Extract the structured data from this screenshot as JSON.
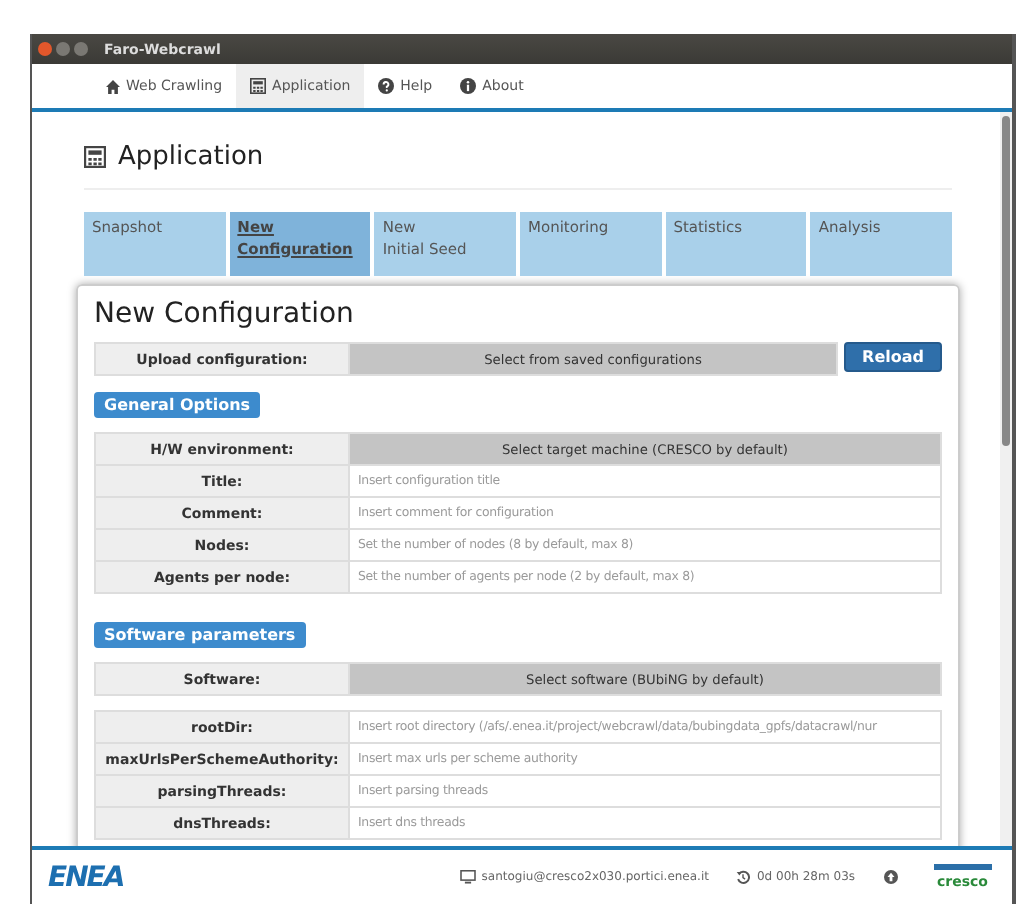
{
  "window": {
    "title": "Faro-Webcrawl"
  },
  "nav": [
    {
      "label": "Web Crawling",
      "selected": false
    },
    {
      "label": "Application",
      "selected": true
    },
    {
      "label": "Help",
      "selected": false
    },
    {
      "label": "About",
      "selected": false
    }
  ],
  "page_heading": "Application",
  "tabs": [
    {
      "label": "Snapshot",
      "selected": false
    },
    {
      "label": "New\nConfiguration",
      "selected": true
    },
    {
      "label": "New\nInitial Seed",
      "selected": false
    },
    {
      "label": "Monitoring",
      "selected": false
    },
    {
      "label": "Statistics",
      "selected": false
    },
    {
      "label": "Analysis",
      "selected": false
    }
  ],
  "card": {
    "title": "New Configuration",
    "upload": {
      "label": "Upload configuration:",
      "value": "Select from saved configurations",
      "button": "Reload"
    },
    "sections": [
      {
        "title": "General Options",
        "groups": [
          [
            {
              "kind": "select",
              "label": "H/W environment:",
              "value": "Select target machine (CRESCO by default)"
            },
            {
              "kind": "input",
              "label": "Title:",
              "placeholder": "Insert configuration title"
            },
            {
              "kind": "input",
              "label": "Comment:",
              "placeholder": "Insert comment for configuration"
            },
            {
              "kind": "input",
              "label": "Nodes:",
              "placeholder": "Set the number of nodes (8 by default, max 8)"
            },
            {
              "kind": "input",
              "label": "Agents per node:",
              "placeholder": "Set the number of agents per node (2 by default, max 8)"
            }
          ]
        ]
      },
      {
        "title": "Software parameters",
        "groups": [
          [
            {
              "kind": "select",
              "label": "Software:",
              "value": "Select software (BUbiNG by default)"
            }
          ],
          [
            {
              "kind": "input",
              "label": "rootDir:",
              "placeholder": "Insert root directory (/afs/.enea.it/project/webcrawl/data/bubingdata_gpfs/datacrawl/nur"
            },
            {
              "kind": "input",
              "label": "maxUrlsPerSchemeAuthority:",
              "placeholder": "Insert max urls per scheme authority"
            },
            {
              "kind": "input",
              "label": "parsingThreads:",
              "placeholder": "Insert parsing threads"
            },
            {
              "kind": "input",
              "label": "dnsThreads:",
              "placeholder": "Insert dns threads"
            }
          ]
        ]
      }
    ]
  },
  "footer": {
    "logo": "ENEA",
    "user": "santogiu@cresco2x030.portici.enea.it",
    "uptime": "0d 00h 28m 03s",
    "partner_logo": "cresco"
  }
}
